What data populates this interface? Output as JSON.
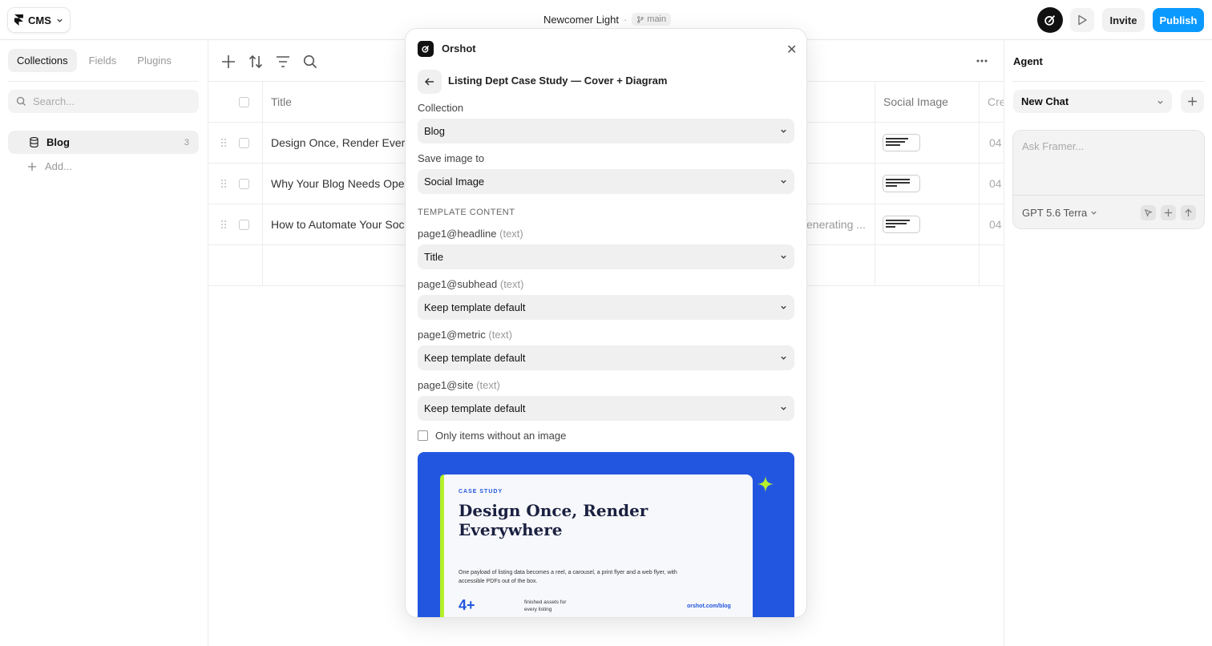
{
  "topbar": {
    "app_menu": "CMS",
    "project_name": "Newcomer Light",
    "separator": "·",
    "branch": "main",
    "invite": "Invite",
    "publish": "Publish"
  },
  "sidebar": {
    "tabs": [
      "Collections",
      "Fields",
      "Plugins"
    ],
    "search_placeholder": "Search...",
    "collection": {
      "name": "Blog",
      "count": "3"
    },
    "add_label": "Add..."
  },
  "table": {
    "columns": {
      "title": "Title",
      "social_image": "Social Image",
      "created": "Cre"
    },
    "rows": [
      {
        "title": "Design Once, Render Every",
        "created": "04",
        "status": ""
      },
      {
        "title": "Why Your Blog Needs Oper",
        "created": "04",
        "status": ""
      },
      {
        "title": "How to Automate Your Soc",
        "created": "04",
        "status": "enerating ..."
      }
    ]
  },
  "agent": {
    "title": "Agent",
    "new_chat": "New Chat",
    "placeholder": "Ask Framer...",
    "model": "GPT 5.6 Terra"
  },
  "modal": {
    "title": "Orshot",
    "template_name": "Listing Dept Case Study — Cover + Diagram",
    "collection_label": "Collection",
    "collection_value": "Blog",
    "save_label": "Save image to",
    "save_value": "Social Image",
    "section": "TEMPLATE CONTENT",
    "fields": [
      {
        "name": "page1@headline",
        "type": "(text)",
        "value": "Title"
      },
      {
        "name": "page1@subhead",
        "type": "(text)",
        "value": "Keep template default"
      },
      {
        "name": "page1@metric",
        "type": "(text)",
        "value": "Keep template default"
      },
      {
        "name": "page1@site",
        "type": "(text)",
        "value": "Keep template default"
      }
    ],
    "only_without_image": "Only items without an image",
    "preview": {
      "eyebrow": "CASE STUDY",
      "headline": "Design Once, Render Everywhere",
      "body": "One payload of listing data becomes a reel, a carousel, a print flyer and a web flyer, with accessible PDFs out of the box.",
      "metric": "4+",
      "metric_label": "finished assets for every listing",
      "site": "orshot.com/blog"
    }
  },
  "colors": {
    "accent": "#0a99ff",
    "preview_bg": "#2356e0",
    "preview_accent": "#b6f02a"
  }
}
